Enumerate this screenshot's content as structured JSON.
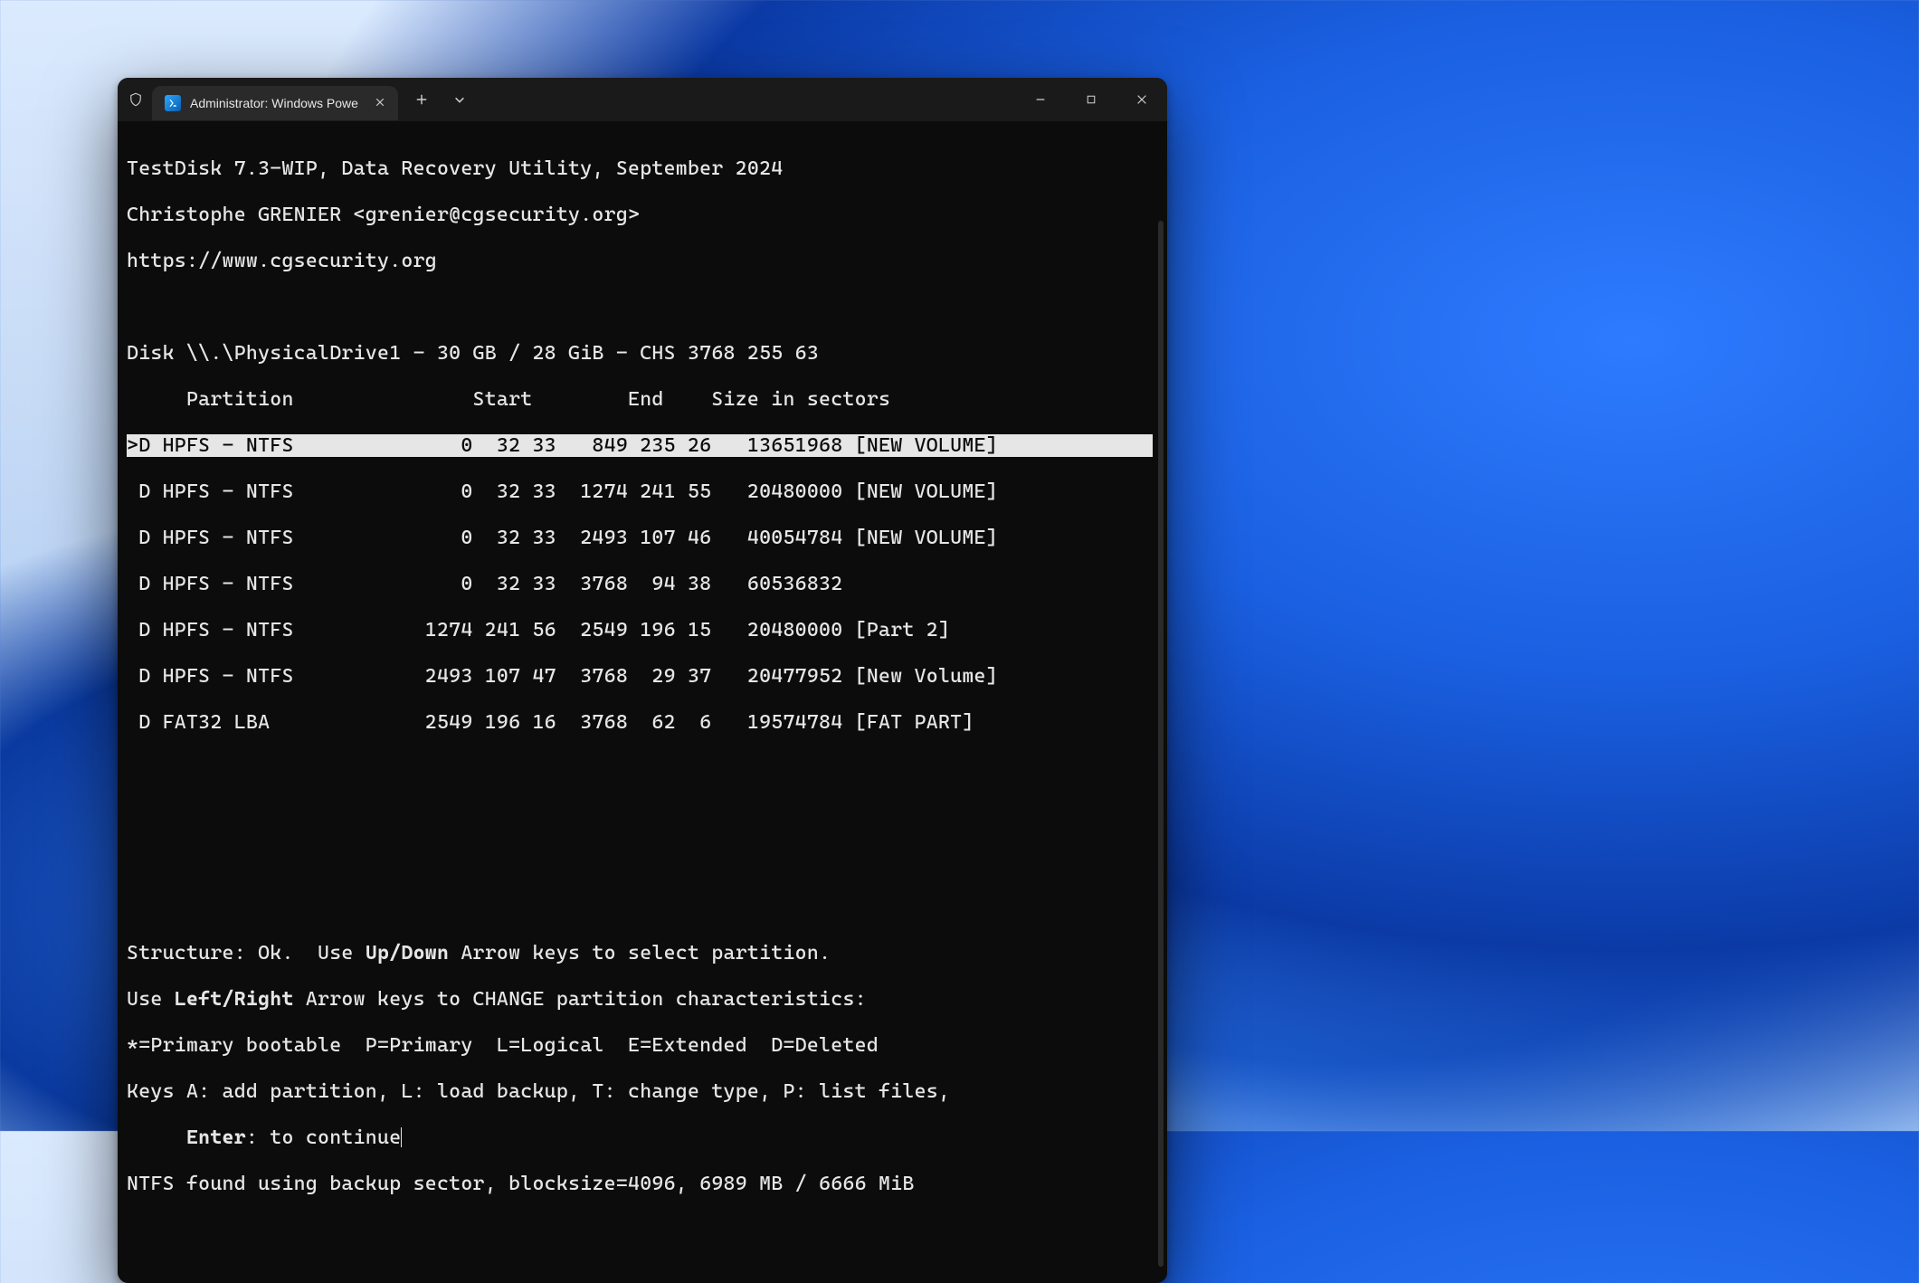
{
  "tab": {
    "title": "Administrator: Windows Powe"
  },
  "term": {
    "header": {
      "line1": "TestDisk 7.3-WIP, Data Recovery Utility, September 2024",
      "line2": "Christophe GRENIER <grenier@cgsecurity.org>",
      "line3": "https://www.cgsecurity.org"
    },
    "disk": "Disk \\\\.\\PhysicalDrive1 - 30 GB / 28 GiB - CHS 3768 255 63",
    "columns": "     Partition               Start        End    Size in sectors",
    "rows": [
      ">D HPFS - NTFS              0  32 33   849 235 26   13651968 [NEW VOLUME]",
      " D HPFS - NTFS              0  32 33  1274 241 55   20480000 [NEW VOLUME]",
      " D HPFS - NTFS              0  32 33  2493 107 46   40054784 [NEW VOLUME]",
      " D HPFS - NTFS              0  32 33  3768  94 38   60536832",
      " D HPFS - NTFS           1274 241 56  2549 196 15   20480000 [Part 2]",
      " D HPFS - NTFS           2493 107 47  3768  29 37   20477952 [New Volume]",
      " D FAT32 LBA             2549 196 16  3768  62  6   19574784 [FAT PART]"
    ],
    "help": {
      "l1a": "Structure: Ok.  Use ",
      "l1b": "Up/Down",
      "l1c": " Arrow keys to select partition.",
      "l2a": "Use ",
      "l2b": "Left/Right",
      "l2c": " Arrow keys to CHANGE partition characteristics:",
      "l3": "*=Primary bootable  P=Primary  L=Logical  E=Extended  D=Deleted",
      "l4": "Keys A: add partition, L: load backup, T: change type, P: list files,",
      "l5a": "     ",
      "l5b": "Enter",
      "l5c": ": to continue",
      "l6": "NTFS found using backup sector, blocksize=4096, 6989 MB / 6666 MiB"
    }
  }
}
